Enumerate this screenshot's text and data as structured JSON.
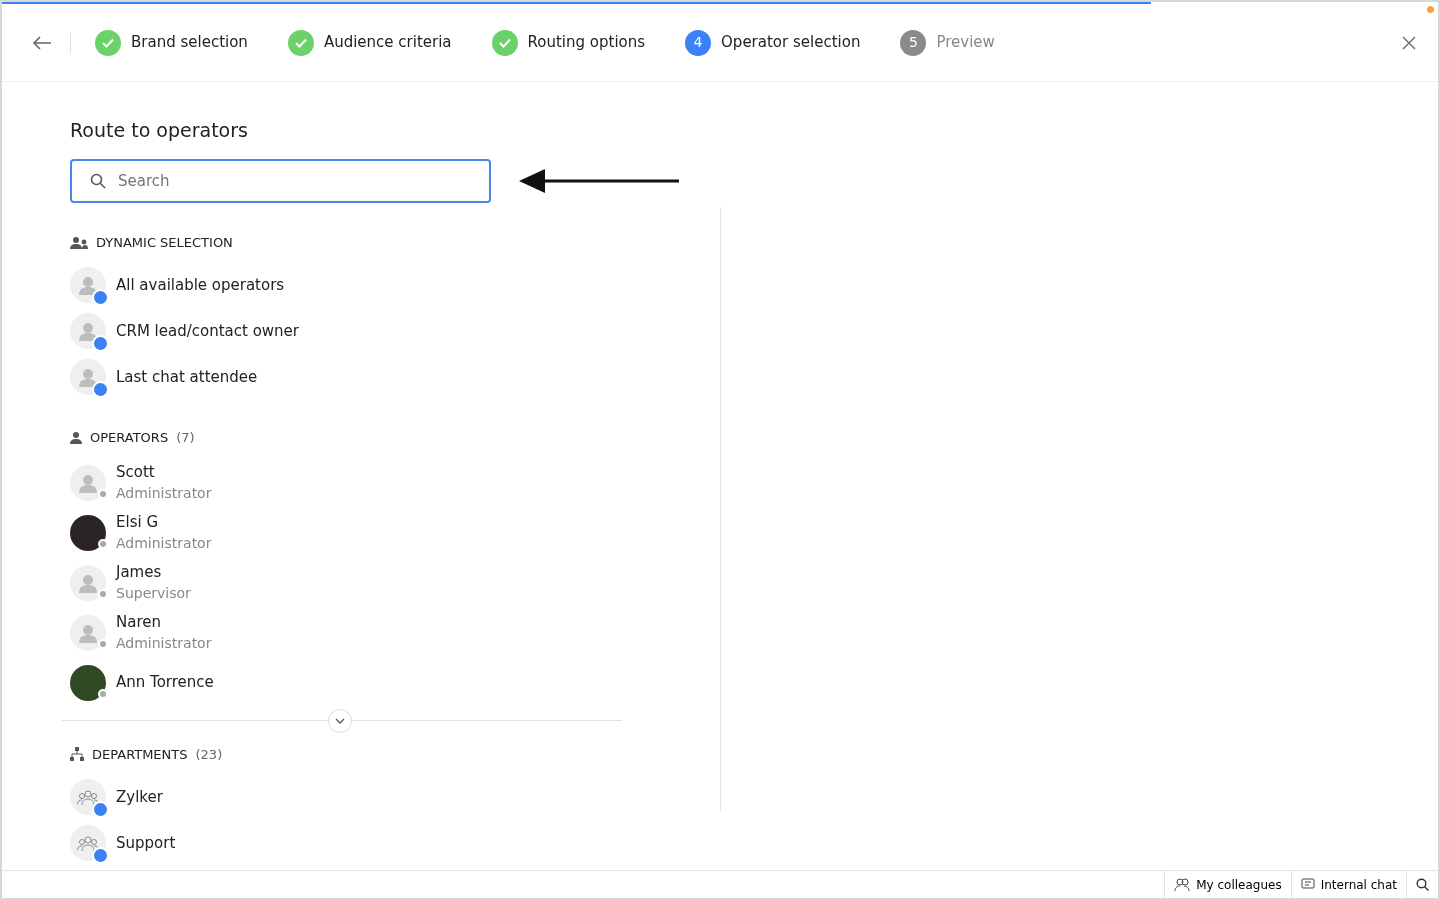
{
  "progress": {
    "level": 0.8
  },
  "steps": [
    {
      "label": "Brand selection",
      "completed": true,
      "selected": false
    },
    {
      "label": "Audience criteria",
      "completed": true,
      "selected": false
    },
    {
      "label": "Routing options",
      "completed": true,
      "selected": false
    },
    {
      "number": "4",
      "label": "Operator selection",
      "completed": false,
      "selected": true
    },
    {
      "number": "5",
      "label": "Preview",
      "completed": false,
      "selected": false
    }
  ],
  "title": "Route to operators",
  "search": {
    "placeholder": "Search"
  },
  "dynamic_selection": {
    "heading": "DYNAMIC SELECTION",
    "items": [
      {
        "name": "All available operators"
      },
      {
        "name": "CRM lead/contact owner"
      },
      {
        "name": "Last chat attendee"
      }
    ]
  },
  "operators": {
    "heading": "OPERATORS",
    "count": "(7)",
    "items": [
      {
        "name": "Scott",
        "role": "Administrator",
        "kind": "silhouette"
      },
      {
        "name": "Elsi G",
        "role": "Administrator",
        "kind": "photo"
      },
      {
        "name": "James",
        "role": "Supervisor",
        "kind": "silhouette"
      },
      {
        "name": "Naren",
        "role": "Administrator",
        "kind": "silhouette"
      },
      {
        "name": "Ann Torrence",
        "kind": "photo"
      }
    ]
  },
  "departments": {
    "heading": "DEPARTMENTS",
    "count": "(23)",
    "items": [
      {
        "name": "Zylker"
      },
      {
        "name": "Support"
      }
    ]
  },
  "footer": {
    "items": [
      {
        "label": "My colleagues",
        "kind": "colleagues"
      },
      {
        "label": "Internal chat",
        "kind": "chat"
      }
    ]
  }
}
